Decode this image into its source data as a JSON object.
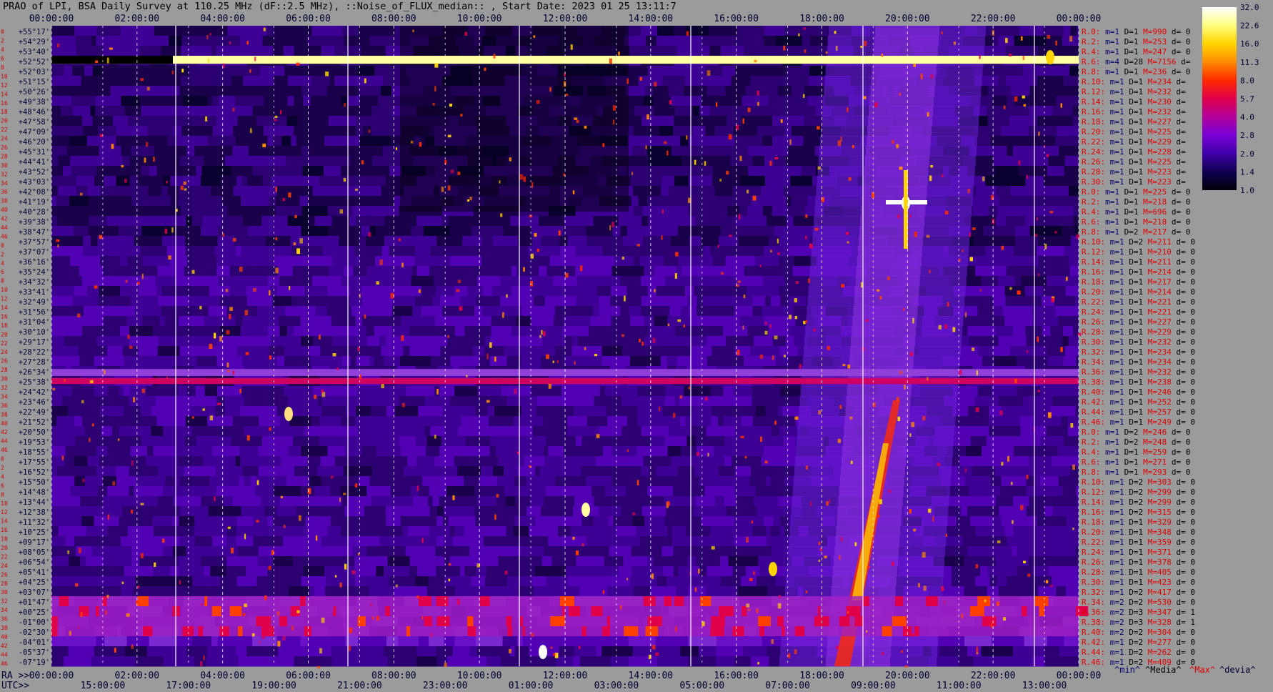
{
  "title": "PRAO of LPI, BSA Daily Survey at 110.25 MHz (dF::2.5 MHz), ::Noise_of_FLUX_median:: , Start Date: 2023 01 25 13:11:7",
  "colorbar": {
    "ticks": [
      "32.0",
      "22.6",
      "16.0",
      "11.3",
      "8.0",
      "5.7",
      "4.0",
      "2.8",
      "2.0",
      "1.4",
      "1.0"
    ],
    "colors": [
      "#ffffff",
      "#ffff80",
      "#ffd400",
      "#ff8a00",
      "#ff2a00",
      "#e0004a",
      "#b0009c",
      "#7a00d6",
      "#3e00a8",
      "#100050",
      "#000008"
    ]
  },
  "chart_data": {
    "type": "heatmap",
    "title": "PRAO of LPI, BSA Daily Survey at 110.25 MHz (dF::2.5 MHz), ::Noise_of_FLUX_median:: , Start Date: 2023 01 25 13:11:7",
    "xlabel_top": "RA >>",
    "xlabel_bottom": "UTC>>",
    "x_ra_hours": [
      0,
      2,
      4,
      6,
      8,
      10,
      12,
      14,
      16,
      18,
      20,
      22,
      24
    ],
    "x_ra_labels": [
      "00:00:00",
      "02:00:00",
      "04:00:00",
      "06:00:00",
      "08:00:00",
      "10:00:00",
      "12:00:00",
      "14:00:00",
      "16:00:00",
      "18:00:00",
      "20:00:00",
      "22:00:00",
      "00:00:00"
    ],
    "x_bottom_ra_labels": [
      "00:00:00",
      "02:00:00",
      "04:00:00",
      "06:00:00",
      "08:00:00",
      "10:00:00",
      "12:00:00",
      "14:00:00",
      "16:00:00",
      "18:00:00",
      "20:00:00",
      "22:00:00",
      "00:00:00"
    ],
    "x_utc_labels": [
      "15:00:00",
      "17:00:00",
      "19:00:00",
      "21:00:00",
      "23:00:00",
      "01:00:00",
      "03:00:00",
      "05:00:00",
      "07:00:00",
      "09:00:00",
      "11:00:00",
      "13:00:00"
    ],
    "beam_index": [
      "0",
      "2",
      "4",
      "6",
      "8",
      "10",
      "12",
      "14",
      "16",
      "18",
      "20",
      "22",
      "24",
      "26",
      "28",
      "30",
      "32",
      "34",
      "36",
      "38",
      "40",
      "42",
      "44",
      "46",
      "0",
      "2",
      "4",
      "6",
      "8",
      "10",
      "12",
      "14",
      "16",
      "18",
      "20",
      "22",
      "24",
      "26",
      "28",
      "30",
      "32",
      "34",
      "36",
      "38",
      "40",
      "42",
      "44",
      "46",
      "0",
      "2",
      "4",
      "6",
      "8",
      "10",
      "12",
      "14",
      "16",
      "18",
      "20",
      "22",
      "24",
      "26",
      "28",
      "30",
      "32",
      "34",
      "36",
      "38",
      "40",
      "42",
      "44",
      "46"
    ],
    "declinations": [
      "+55°17'",
      "+54°29'",
      "+53°40'",
      "+52°52'",
      "+52°03'",
      "+51°15'",
      "+50°26'",
      "+49°38'",
      "+48°46'",
      "+47°58'",
      "+47°09'",
      "+46°20'",
      "+45°31'",
      "+44°41'",
      "+43°52'",
      "+43°03'",
      "+42°08'",
      "+41°19'",
      "+40°28'",
      "+39°38'",
      "+38°47'",
      "+37°57'",
      "+37°07'",
      "+36°16'",
      "+35°24'",
      "+34°32'",
      "+33°41'",
      "+32°49'",
      "+31°56'",
      "+31°04'",
      "+30°10'",
      "+29°17'",
      "+28°22'",
      "+27°28'",
      "+26°34'",
      "+25°38'",
      "+24°42'",
      "+23°46'",
      "+22°49'",
      "+21°52'",
      "+20°50'",
      "+19°53'",
      "+18°55'",
      "+17°55'",
      "+16°52'",
      "+15°50'",
      "+14°48'",
      "+13°44'",
      "+12°38'",
      "+11°32'",
      "+10°25'",
      "+09°17'",
      "+08°05'",
      "+06°54'",
      "+05°41'",
      "+04°25'",
      "+03°07'",
      "+01°47'",
      "+00°25'",
      "-01°00'",
      "-02°30'",
      "-04°01'",
      "-05°37'",
      "-07°19'"
    ],
    "stats_header": [
      "^min^",
      "^Media^",
      "^Max^",
      "^devia^"
    ],
    "stats": [
      {
        "ray": "R.0:",
        "m": "1",
        "D": "1",
        "M": "990",
        "d": "0"
      },
      {
        "ray": "R.2:",
        "m": "1",
        "D": "1",
        "M": "253",
        "d": "0"
      },
      {
        "ray": "R.4:",
        "m": "1",
        "D": "1",
        "M": "247",
        "d": "0"
      },
      {
        "ray": "R.6:",
        "m": "4",
        "D": "28",
        "M": "7156",
        "d": ""
      },
      {
        "ray": "R.8:",
        "m": "1",
        "D": "1",
        "M": "236",
        "d": "0"
      },
      {
        "ray": "R.10:",
        "m": "1",
        "D": "1",
        "M": "234",
        "d": ""
      },
      {
        "ray": "R.12:",
        "m": "1",
        "D": "1",
        "M": "232",
        "d": ""
      },
      {
        "ray": "R.14:",
        "m": "1",
        "D": "1",
        "M": "230",
        "d": ""
      },
      {
        "ray": "R.16:",
        "m": "1",
        "D": "1",
        "M": "232",
        "d": ""
      },
      {
        "ray": "R.18:",
        "m": "1",
        "D": "1",
        "M": "227",
        "d": ""
      },
      {
        "ray": "R.20:",
        "m": "1",
        "D": "1",
        "M": "225",
        "d": ""
      },
      {
        "ray": "R.22:",
        "m": "1",
        "D": "1",
        "M": "229",
        "d": ""
      },
      {
        "ray": "R.24:",
        "m": "1",
        "D": "1",
        "M": "228",
        "d": ""
      },
      {
        "ray": "R.26:",
        "m": "1",
        "D": "1",
        "M": "225",
        "d": ""
      },
      {
        "ray": "R.28:",
        "m": "1",
        "D": "1",
        "M": "223",
        "d": ""
      },
      {
        "ray": "R.30:",
        "m": "1",
        "D": "1",
        "M": "223",
        "d": ""
      },
      {
        "ray": "R.0:",
        "m": "1",
        "D": "1",
        "M": "225",
        "d": "0"
      },
      {
        "ray": "R.2:",
        "m": "1",
        "D": "1",
        "M": "218",
        "d": "0"
      },
      {
        "ray": "R.4:",
        "m": "1",
        "D": "1",
        "M": "696",
        "d": "0"
      },
      {
        "ray": "R.6:",
        "m": "1",
        "D": "1",
        "M": "218",
        "d": "0"
      },
      {
        "ray": "R.8:",
        "m": "1",
        "D": "2",
        "M": "217",
        "d": "0"
      },
      {
        "ray": "R.10:",
        "m": "1",
        "D": "2",
        "M": "211",
        "d": "0"
      },
      {
        "ray": "R.12:",
        "m": "1",
        "D": "1",
        "M": "210",
        "d": "0"
      },
      {
        "ray": "R.14:",
        "m": "1",
        "D": "1",
        "M": "211",
        "d": "0"
      },
      {
        "ray": "R.16:",
        "m": "1",
        "D": "1",
        "M": "214",
        "d": "0"
      },
      {
        "ray": "R.18:",
        "m": "1",
        "D": "1",
        "M": "217",
        "d": "0"
      },
      {
        "ray": "R.20:",
        "m": "1",
        "D": "1",
        "M": "214",
        "d": "0"
      },
      {
        "ray": "R.22:",
        "m": "1",
        "D": "1",
        "M": "221",
        "d": "0"
      },
      {
        "ray": "R.24:",
        "m": "1",
        "D": "1",
        "M": "221",
        "d": "0"
      },
      {
        "ray": "R.26:",
        "m": "1",
        "D": "1",
        "M": "227",
        "d": "0"
      },
      {
        "ray": "R.28:",
        "m": "1",
        "D": "1",
        "M": "229",
        "d": "0"
      },
      {
        "ray": "R.30:",
        "m": "1",
        "D": "1",
        "M": "232",
        "d": "0"
      },
      {
        "ray": "R.32:",
        "m": "1",
        "D": "1",
        "M": "234",
        "d": "0"
      },
      {
        "ray": "R.34:",
        "m": "1",
        "D": "1",
        "M": "234",
        "d": "0"
      },
      {
        "ray": "R.36:",
        "m": "1",
        "D": "1",
        "M": "232",
        "d": "0"
      },
      {
        "ray": "R.38:",
        "m": "1",
        "D": "1",
        "M": "238",
        "d": "0"
      },
      {
        "ray": "R.40:",
        "m": "1",
        "D": "1",
        "M": "246",
        "d": "0"
      },
      {
        "ray": "R.42:",
        "m": "1",
        "D": "1",
        "M": "252",
        "d": "0"
      },
      {
        "ray": "R.44:",
        "m": "1",
        "D": "1",
        "M": "257",
        "d": "0"
      },
      {
        "ray": "R.46:",
        "m": "1",
        "D": "1",
        "M": "249",
        "d": "0"
      },
      {
        "ray": "R.0:",
        "m": "1",
        "D": "2",
        "M": "246",
        "d": "0"
      },
      {
        "ray": "R.2:",
        "m": "1",
        "D": "2",
        "M": "248",
        "d": "0"
      },
      {
        "ray": "R.4:",
        "m": "1",
        "D": "1",
        "M": "259",
        "d": "0"
      },
      {
        "ray": "R.6:",
        "m": "1",
        "D": "1",
        "M": "271",
        "d": "0"
      },
      {
        "ray": "R.8:",
        "m": "1",
        "D": "1",
        "M": "293",
        "d": "0"
      },
      {
        "ray": "R.10:",
        "m": "1",
        "D": "2",
        "M": "303",
        "d": "0"
      },
      {
        "ray": "R.12:",
        "m": "1",
        "D": "2",
        "M": "299",
        "d": "0"
      },
      {
        "ray": "R.14:",
        "m": "1",
        "D": "2",
        "M": "299",
        "d": "0"
      },
      {
        "ray": "R.16:",
        "m": "1",
        "D": "2",
        "M": "315",
        "d": "0"
      },
      {
        "ray": "R.18:",
        "m": "1",
        "D": "1",
        "M": "329",
        "d": "0"
      },
      {
        "ray": "R.20:",
        "m": "1",
        "D": "1",
        "M": "348",
        "d": "0"
      },
      {
        "ray": "R.22:",
        "m": "1",
        "D": "1",
        "M": "359",
        "d": "0"
      },
      {
        "ray": "R.24:",
        "m": "1",
        "D": "1",
        "M": "371",
        "d": "0"
      },
      {
        "ray": "R.26:",
        "m": "1",
        "D": "1",
        "M": "378",
        "d": "0"
      },
      {
        "ray": "R.28:",
        "m": "1",
        "D": "1",
        "M": "405",
        "d": "0"
      },
      {
        "ray": "R.30:",
        "m": "1",
        "D": "1",
        "M": "423",
        "d": "0"
      },
      {
        "ray": "R.32:",
        "m": "1",
        "D": "2",
        "M": "417",
        "d": "0"
      },
      {
        "ray": "R.34:",
        "m": "2",
        "D": "2",
        "M": "530",
        "d": "0"
      },
      {
        "ray": "R.36:",
        "m": "2",
        "D": "3",
        "M": "347",
        "d": "1"
      },
      {
        "ray": "R.38:",
        "m": "2",
        "D": "3",
        "M": "328",
        "d": "1"
      },
      {
        "ray": "R.40:",
        "m": "2",
        "D": "2",
        "M": "304",
        "d": "0"
      },
      {
        "ray": "R.42:",
        "m": "1",
        "D": "2",
        "M": "277",
        "d": "0"
      },
      {
        "ray": "R.44:",
        "m": "1",
        "D": "2",
        "M": "262",
        "d": "0"
      },
      {
        "ray": "R.46:",
        "m": "1",
        "D": "2",
        "M": "409",
        "d": "0"
      }
    ],
    "grid": true,
    "legend_placement": "right"
  }
}
